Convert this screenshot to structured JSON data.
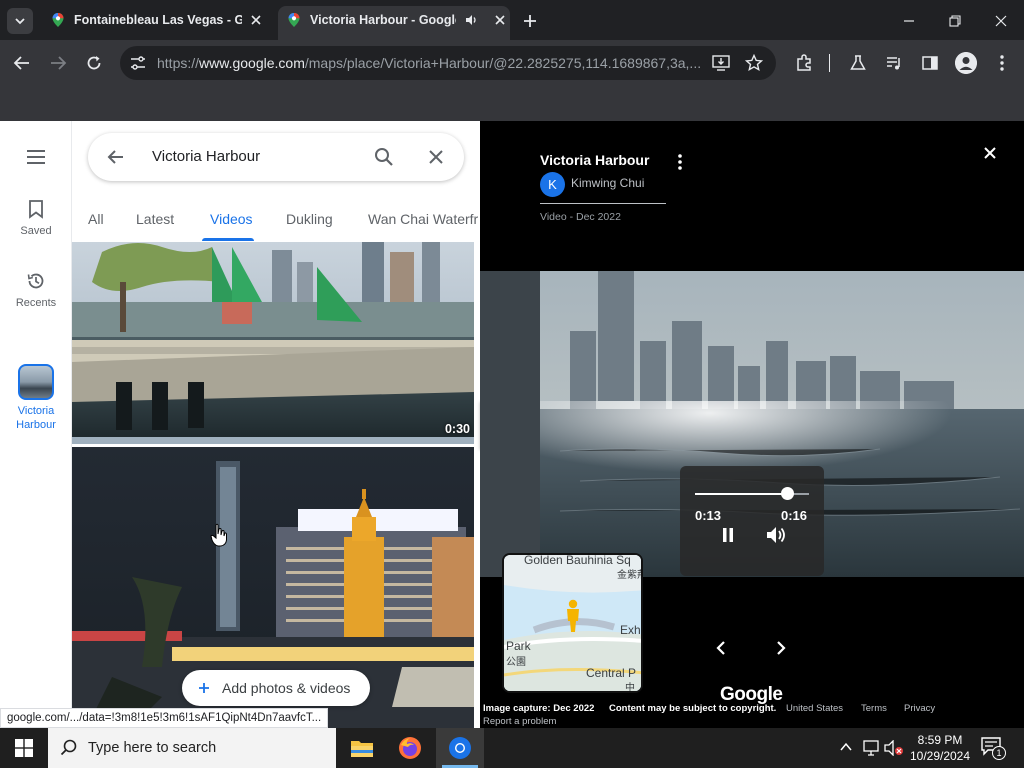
{
  "browser": {
    "tabs": [
      {
        "title": "Fontainebleau Las Vegas - Goo"
      },
      {
        "title": "Victoria Harbour - Google M"
      }
    ],
    "url_prefix": "https://",
    "url_domain": "www.google.com",
    "url_path": "/maps/place/Victoria+Harbour/@22.2825275,114.1689867,3a,..."
  },
  "rail": {
    "saved_label": "Saved",
    "recents_label": "Recents",
    "place_label": "Victoria Harbour"
  },
  "search": {
    "query": "Victoria Harbour"
  },
  "filters": {
    "all": "All",
    "latest": "Latest",
    "videos": "Videos",
    "dukling": "Dukling",
    "wanchai": "Wan Chai Waterfr"
  },
  "gallery": {
    "first_duration": "0:30",
    "add_button": "Add photos & videos"
  },
  "viewer": {
    "title": "Victoria Harbour",
    "author_initial": "K",
    "author": "Kimwing Chui",
    "meta": "Video - Dec 2022",
    "current_time": "0:13",
    "total_time": "0:16",
    "progress": 0.81,
    "minimap": {
      "label1": "Golden Bauhinia Sq",
      "label1_cn": "金紫荊",
      "label2": "Exhi",
      "label3": "Park",
      "label3_cn": "公園",
      "label4": "Central P",
      "label4_cn": "中"
    },
    "logo": "Google",
    "footer": {
      "capture": "Image capture: Dec 2022",
      "copyright": "Content may be subject to copyright.",
      "country": "United States",
      "terms": "Terms",
      "privacy": "Privacy",
      "report": "Report a problem"
    }
  },
  "status_bar_url": "google.com/.../data=!3m8!1e5!3m6!1sAF1QipNt4Dn7aavfcT...",
  "taskbar": {
    "search_placeholder": "Type here to search",
    "time": "8:59 PM",
    "date": "10/29/2024",
    "notification_count": "1"
  },
  "colors": {
    "accent": "#1a73e8",
    "chrome_dark": "#202124",
    "chrome_toolbar": "#35363a"
  }
}
